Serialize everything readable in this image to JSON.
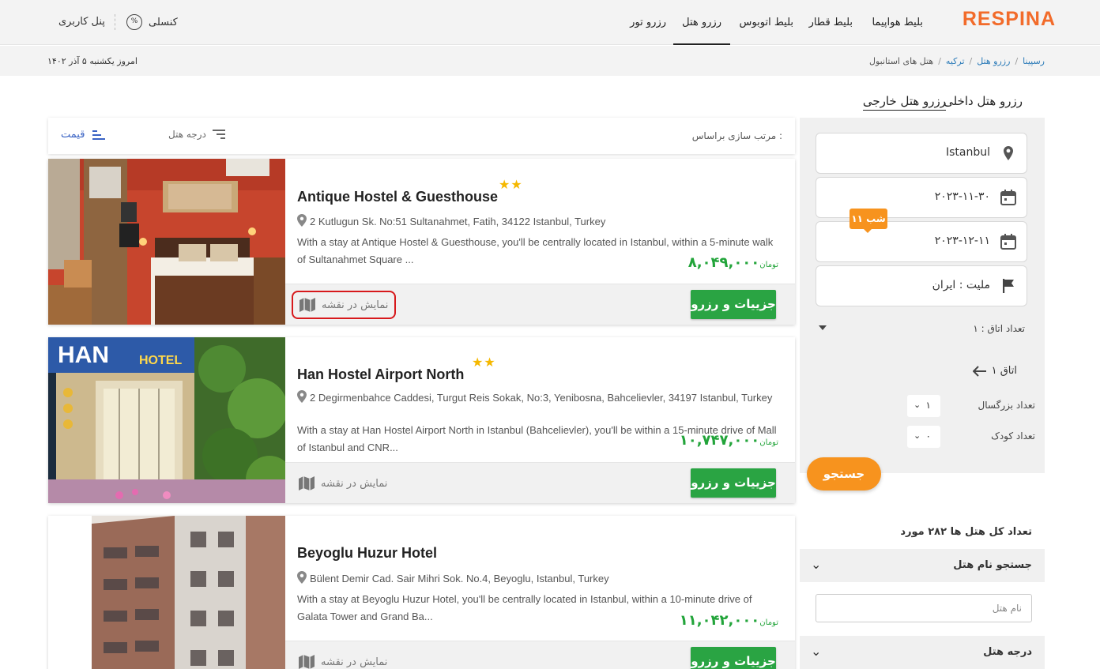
{
  "header": {
    "logo": "RESPINA",
    "nav": [
      "بلیط هواپیما",
      "بلیط قطار",
      "بلیط اتوبوس",
      "رزرو هتل",
      "رزرو تور"
    ],
    "console_label": "کنسلی",
    "console_icon": "%",
    "user_panel": "پنل کاربری"
  },
  "breadcrumb": {
    "items": [
      "رسپینا",
      "رزرو هتل",
      "ترکیه",
      "هتل های استانبول"
    ],
    "today": "امروز یکشنبه ۵ آذر ۱۴۰۲"
  },
  "tabs": {
    "domestic": "رزرو هتل داخلی",
    "foreign": "رزرو هتل خارجی"
  },
  "sort": {
    "label": "مرتب سازی براساس :",
    "grade": "درجه هتل",
    "price": "قیمت"
  },
  "hotels": [
    {
      "name": "Antique Hostel & Guesthouse",
      "stars": "★★",
      "address": "2 Kutlugun Sk. No:51 Sultanahmet, Fatih, 34122 Istanbul, Turkey",
      "description": "With a stay at Antique Hostel & Guesthouse, you'll be centrally located in Istanbul, within a 5-minute walk of Sultanahmet Square ...",
      "price": "۸,۰۴۹,۰۰۰",
      "currency": "تومان",
      "book_label": "جزییات و رزرو",
      "map_label": "نمایش در نقشه"
    },
    {
      "name": "Han Hostel Airport North",
      "stars": "★★",
      "address": "2 Degirmenbahce Caddesi, Turgut Reis Sokak, No:3, Yenibosna, Bahcelievler, 34197 Istanbul, Turkey",
      "description": "With a stay at Han Hostel Airport North in Istanbul (Bahcelievler), you'll be within a 15-minute drive of Mall of Istanbul and CNR...",
      "price": "۱۰,۷۴۷,۰۰۰",
      "currency": "تومان",
      "book_label": "جزییات و رزرو",
      "map_label": "نمایش در نقشه",
      "sign_han": "HAN",
      "sign_hotel": "HOTEL"
    },
    {
      "name": "Beyoglu Huzur Hotel",
      "stars": "",
      "address": "Bülent Demir Cad. Sair Mihri Sok. No.4, Beyoglu, Istanbul, Turkey",
      "description": "With a stay at Beyoglu Huzur Hotel, you'll be centrally located in Istanbul, within a 10-minute drive of Galata Tower and Grand Ba...",
      "price": "۱۱,۰۴۲,۰۰۰",
      "currency": "تومان",
      "book_label": "جزییات و رزرو",
      "map_label": "نمایش در نقشه"
    }
  ],
  "search": {
    "city": "Istanbul",
    "checkin": "۲۰۲۳-۱۱-۳۰",
    "checkout": "۲۰۲۳-۱۲-۱۱",
    "nights": "۱۱ شب",
    "nationality": "ملیت : ایران",
    "rooms": "تعداد اتاق : ۱",
    "room1": "اتاق ۱",
    "adults_label": "تعداد بزرگسال",
    "adults_value": "۱",
    "children_label": "تعداد کودک",
    "children_value": "۰",
    "button": "جستجو"
  },
  "filters": {
    "total": "تعداد کل هتل ها ۲۸۲ مورد",
    "name_search": "جستجو نام هتل",
    "name_placeholder": "نام هتل",
    "grade": "درجه هتل"
  },
  "colors": {
    "brand": "#f26b2a",
    "book_button": "#2aa443",
    "price": "#22a43a",
    "search_button": "#f7931e",
    "stars": "#f5b800",
    "highlight": "#d7191c"
  }
}
